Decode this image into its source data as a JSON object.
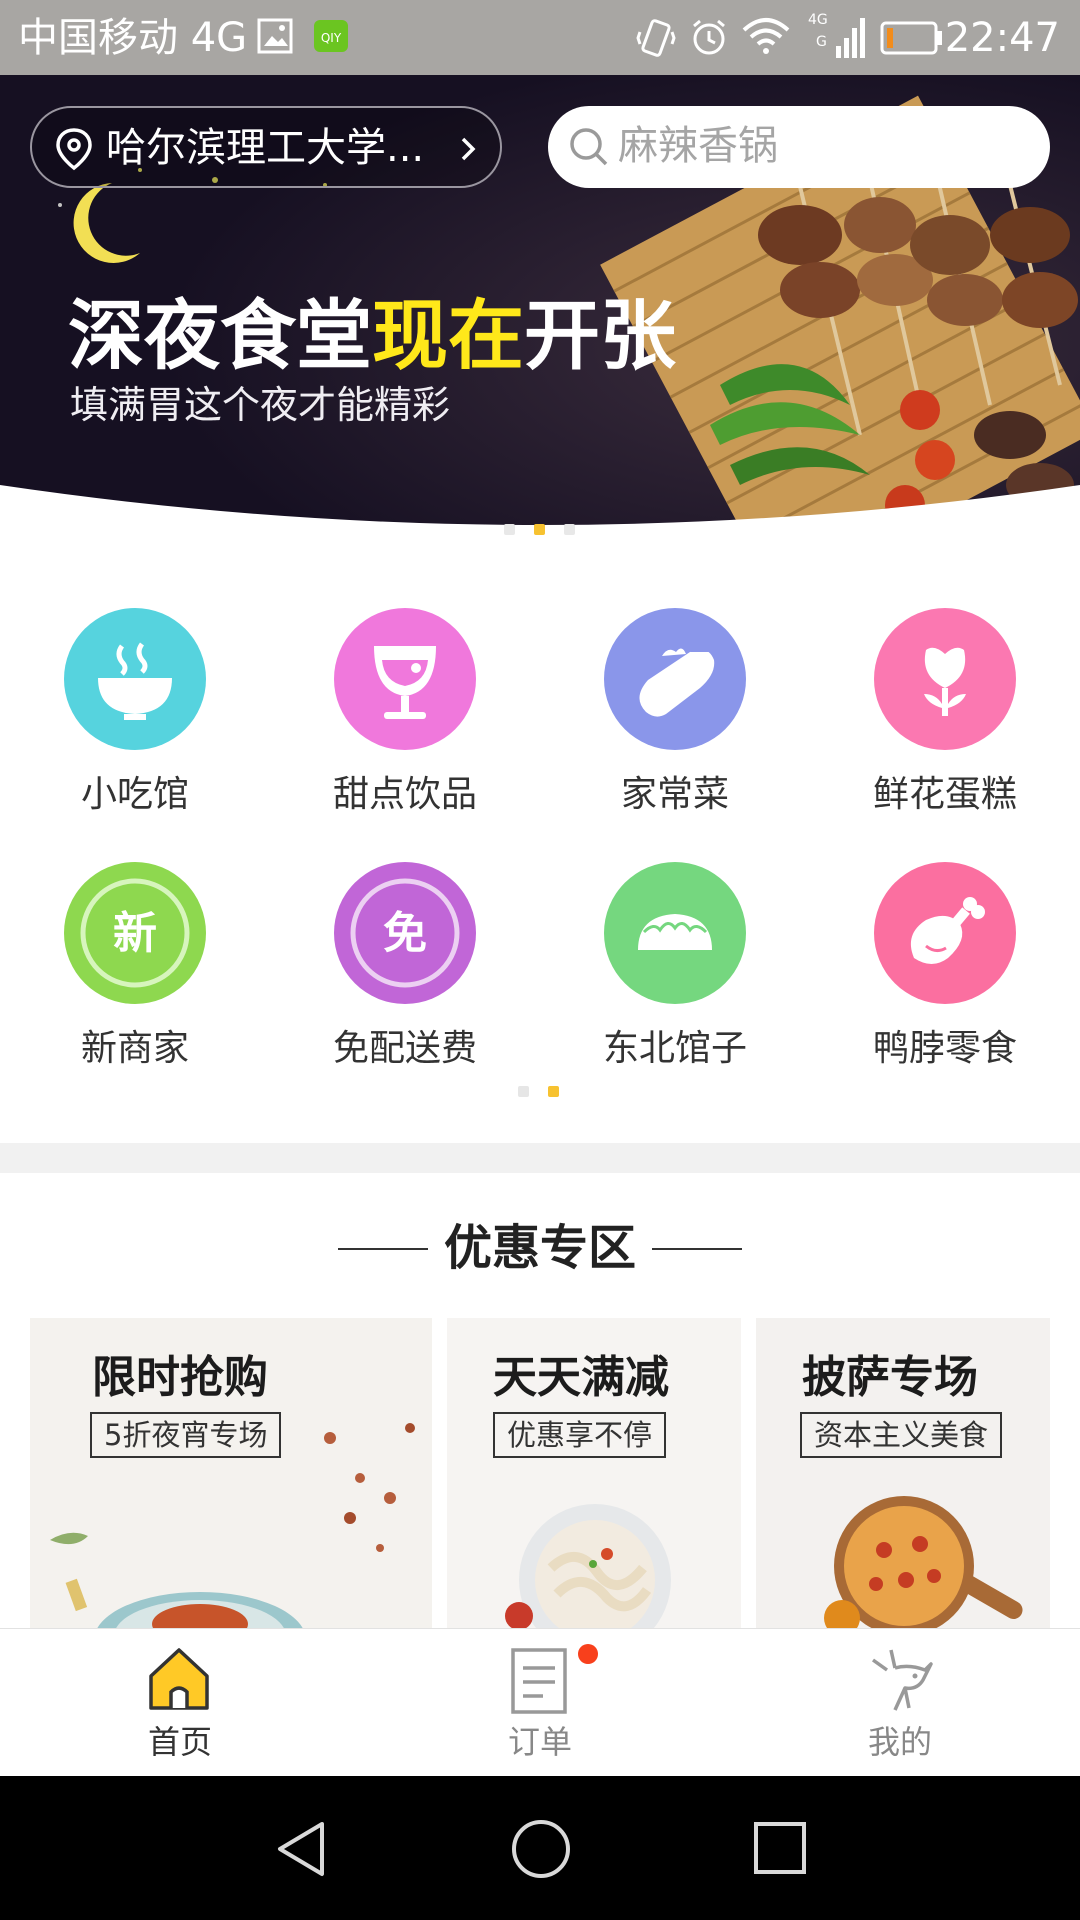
{
  "status_bar": {
    "carrier": "中国移动 4G",
    "time": "22:47",
    "icons": [
      "image-icon",
      "iqiyi-app-icon",
      "vibrate-icon",
      "alarm-icon",
      "wifi-icon",
      "signal-4g-icon",
      "battery-low-icon"
    ]
  },
  "header": {
    "location": "哈尔滨理工大学...",
    "search_placeholder": "麻辣香锅"
  },
  "banner": {
    "title_before": "深夜食堂",
    "title_highlight": "现在",
    "title_after": "开张",
    "subtitle": "填满胃这个夜才能精彩",
    "slide_count": 3,
    "active_slide": 2,
    "highlight_color": "#ffe81a"
  },
  "categories": {
    "items": [
      {
        "label": "小吃馆",
        "icon": "noodle-bowl-icon",
        "color": "#56d3de"
      },
      {
        "label": "甜点饮品",
        "icon": "drink-glass-icon",
        "color": "#f078dc"
      },
      {
        "label": "家常菜",
        "icon": "eggplant-icon",
        "color": "#8a96ea"
      },
      {
        "label": "鲜花蛋糕",
        "icon": "flower-icon",
        "color": "#fb78b1"
      },
      {
        "label": "新商家",
        "icon": "new-badge-icon",
        "glyph": "新",
        "color": "#8ed84f"
      },
      {
        "label": "免配送费",
        "icon": "free-badge-icon",
        "glyph": "免",
        "color": "#c166d7"
      },
      {
        "label": "东北馆子",
        "icon": "dumpling-icon",
        "color": "#75d77f"
      },
      {
        "label": "鸭脖零食",
        "icon": "drumstick-icon",
        "color": "#fb6fa0"
      }
    ],
    "page_count": 2,
    "active_page": 2
  },
  "promo": {
    "section_title": "优惠专区",
    "cards": [
      {
        "title": "限时抢购",
        "tag": "5折夜宵专场"
      },
      {
        "title": "天天满减",
        "tag": "优惠享不停"
      },
      {
        "title": "披萨专场",
        "tag": "资本主义美食"
      }
    ]
  },
  "bottom_nav": {
    "items": [
      {
        "label": "首页",
        "icon": "home-icon",
        "active": true
      },
      {
        "label": "订单",
        "icon": "order-list-icon",
        "has_badge": true
      },
      {
        "label": "我的",
        "icon": "deer-profile-icon"
      }
    ],
    "accent_color": "#ffc926",
    "badge_color": "#f8401c"
  },
  "android_nav": [
    "back-icon",
    "home-circle-icon",
    "recents-icon"
  ]
}
